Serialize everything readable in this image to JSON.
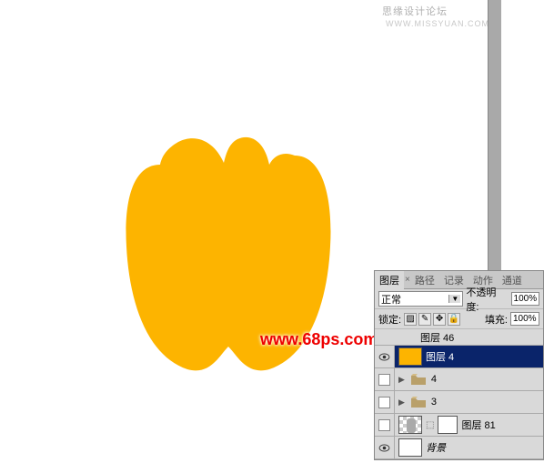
{
  "watermark": {
    "top_cn": "思缘设计论坛",
    "top_en": "WWW.MISSYUAN.COM",
    "url": "www.68ps.com"
  },
  "panel": {
    "tabs": {
      "layers": "图层",
      "paths": "路径",
      "history": "记录",
      "actions": "动作",
      "channels": "通道"
    },
    "blend_mode": "正常",
    "opacity_label": "不透明度:",
    "opacity_value": "100%",
    "lock_label": "锁定:",
    "fill_label": "填充:",
    "fill_value": "100%"
  },
  "layers": {
    "l0": "图层 46",
    "l1": "图层 4",
    "l2": "4",
    "l3": "3",
    "l4": "图层 81",
    "l5": "背景"
  },
  "shape_color": "#fdb400"
}
